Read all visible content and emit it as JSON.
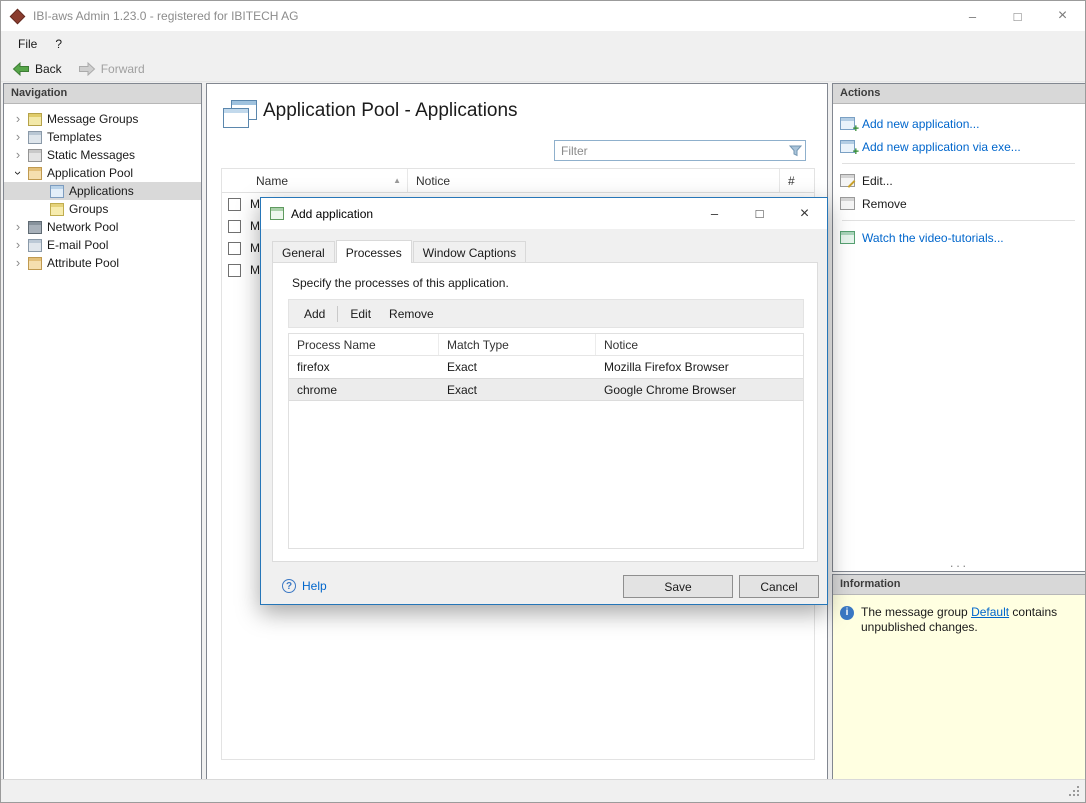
{
  "window": {
    "title": "IBI-aws Admin 1.23.0 - registered for IBITECH AG"
  },
  "icons": {
    "minimize": "–",
    "maximize": "□",
    "close": "×",
    "sort_ascending": "▲",
    "splitter_dots": "···",
    "help": "?",
    "info": "i"
  },
  "colors": {
    "link": "#0066cc",
    "dialog_border": "#2676b8",
    "info_background": "#ffffe1",
    "selection_background": "#d9d9d9"
  },
  "menu": {
    "items": [
      {
        "label": "File"
      },
      {
        "label": "?"
      }
    ]
  },
  "toolbar": {
    "back": "Back",
    "forward": "Forward"
  },
  "navigation": {
    "header": "Navigation",
    "items": [
      {
        "label": "Message Groups",
        "state": "collapsed",
        "icon": "message-groups-icon"
      },
      {
        "label": "Templates",
        "state": "collapsed",
        "icon": "templates-icon"
      },
      {
        "label": "Static Messages",
        "state": "collapsed",
        "icon": "static-messages-icon"
      },
      {
        "label": "Application Pool",
        "state": "expanded",
        "icon": "application-pool-icon"
      },
      {
        "label": "Applications",
        "state": "leaf",
        "icon": "applications-icon",
        "selected": true
      },
      {
        "label": "Groups",
        "state": "leaf",
        "icon": "groups-icon"
      },
      {
        "label": "Network Pool",
        "state": "collapsed",
        "icon": "network-pool-icon"
      },
      {
        "label": "E-mail Pool",
        "state": "collapsed",
        "icon": "email-pool-icon"
      },
      {
        "label": "Attribute Pool",
        "state": "collapsed",
        "icon": "attribute-pool-icon"
      }
    ]
  },
  "main": {
    "title": "Application Pool - Applications",
    "filter_placeholder": "Filter",
    "table": {
      "columns": [
        "Name",
        "Notice",
        "#"
      ],
      "rows": [
        {
          "name": "M"
        },
        {
          "name": "M"
        },
        {
          "name": "M"
        },
        {
          "name": "M"
        }
      ]
    }
  },
  "dialog": {
    "title": "Add application",
    "tabs": [
      {
        "label": "General"
      },
      {
        "label": "Processes",
        "active": true
      },
      {
        "label": "Window Captions"
      }
    ],
    "description": "Specify the processes of this application.",
    "toolbar": {
      "add": "Add",
      "edit": "Edit",
      "remove": "Remove"
    },
    "table": {
      "columns": [
        "Process Name",
        "Match Type",
        "Notice"
      ],
      "rows": [
        {
          "process": "firefox",
          "match": "Exact",
          "notice": "Mozilla Firefox Browser"
        },
        {
          "process": "chrome",
          "match": "Exact",
          "notice": "Google Chrome Browser",
          "selected": true
        }
      ]
    },
    "help": "Help",
    "save": "Save",
    "cancel": "Cancel"
  },
  "actions": {
    "header": "Actions",
    "items": [
      {
        "label": "Add new application...",
        "type": "link",
        "icon": "add-application-icon"
      },
      {
        "label": "Add new application via exe...",
        "type": "link",
        "icon": "add-application-exe-icon"
      },
      {
        "label": "Edit...",
        "type": "text",
        "icon": "edit-icon"
      },
      {
        "label": "Remove",
        "type": "text",
        "icon": "remove-icon"
      },
      {
        "label": "Watch the video-tutorials...",
        "type": "link",
        "icon": "video-tutorials-icon"
      }
    ]
  },
  "information": {
    "header": "Information",
    "text_before": "The message group ",
    "link": "Default",
    "text_after": " contains unpublished changes."
  }
}
